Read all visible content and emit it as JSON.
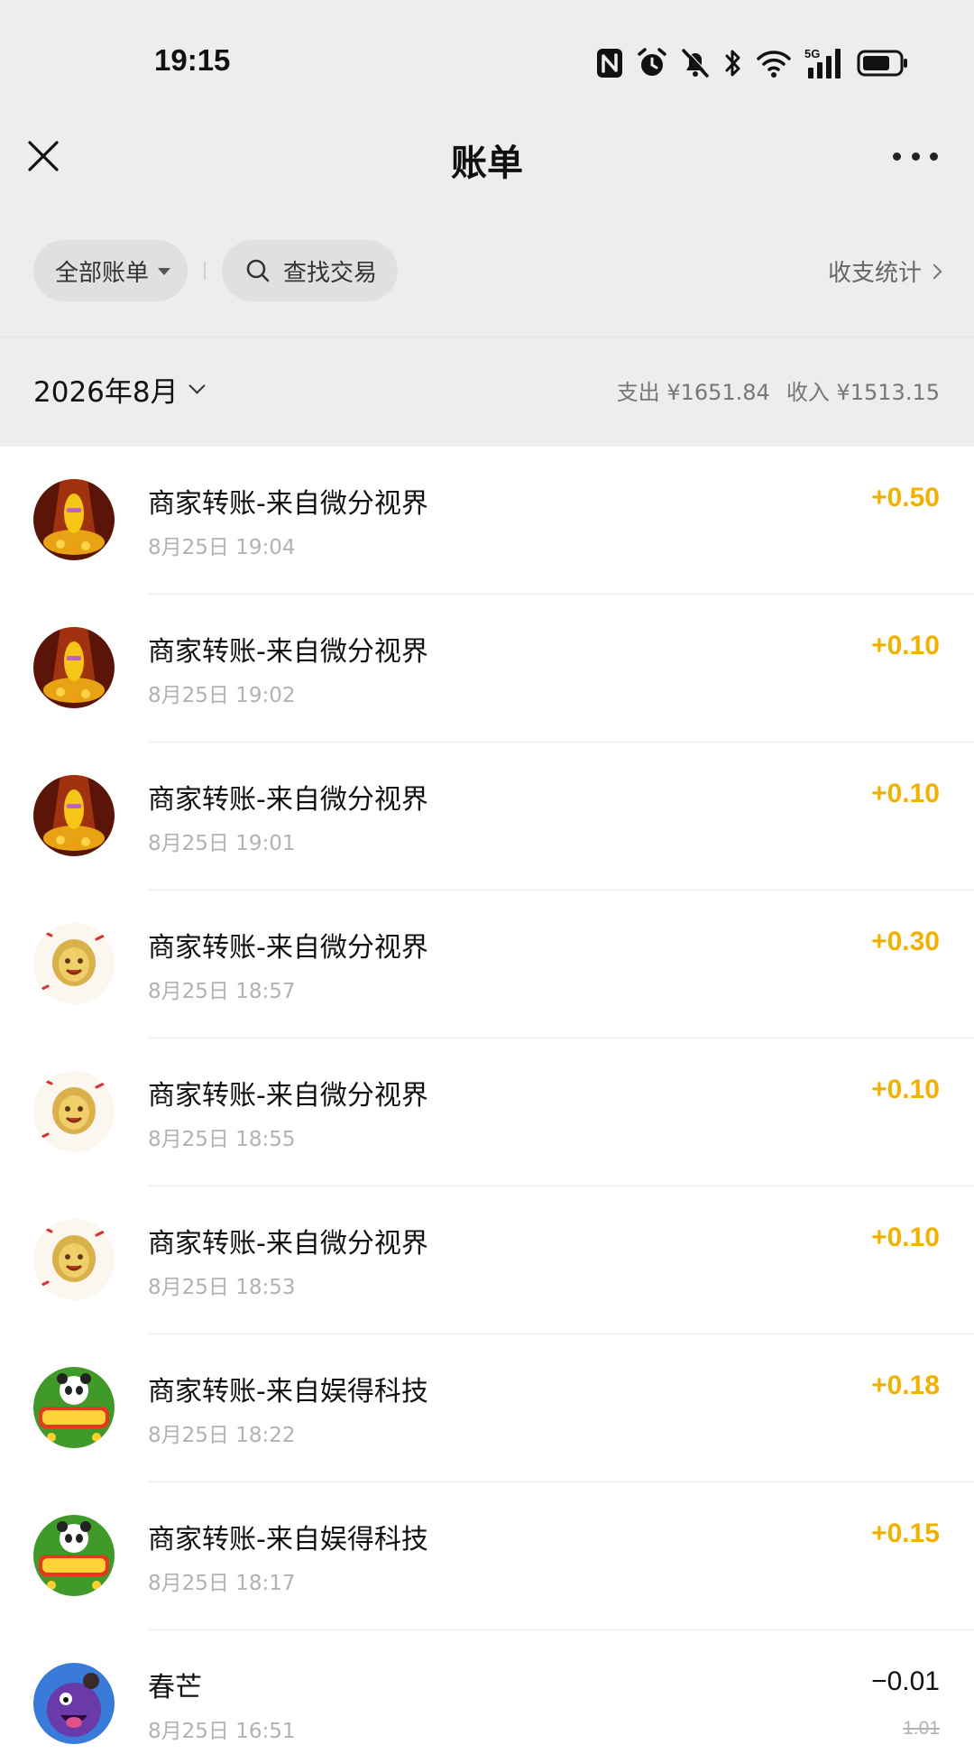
{
  "status_bar": {
    "time": "19:15",
    "icons": [
      "nfc-icon",
      "alarm-icon",
      "mute-icon",
      "bluetooth-icon",
      "wifi-icon",
      "signal-5g-icon",
      "battery-icon"
    ],
    "network_label": "5G"
  },
  "nav": {
    "title": "账单",
    "close_icon": "close-icon",
    "more_icon": "more-icon"
  },
  "filters": {
    "all_bills": "全部账单",
    "search": "查找交易",
    "stats": "收支统计"
  },
  "month_bar": {
    "month": "2026年8月",
    "expense": "支出 ¥1651.84",
    "income": "收入 ¥1513.15"
  },
  "colors": {
    "income_amount": "#f2b100",
    "expense_amount": "#111111",
    "header_bg": "#ededed"
  },
  "transactions": [
    {
      "title": "商家转账-来自微分视界",
      "time": "8月25日 19:04",
      "amount": "+0.50",
      "type": "income",
      "avatar": "banana-character-avatar"
    },
    {
      "title": "商家转账-来自微分视界",
      "time": "8月25日 19:02",
      "amount": "+0.10",
      "type": "income",
      "avatar": "banana-character-avatar"
    },
    {
      "title": "商家转账-来自微分视界",
      "time": "8月25日 19:01",
      "amount": "+0.10",
      "type": "income",
      "avatar": "banana-character-avatar"
    },
    {
      "title": "商家转账-来自微分视界",
      "time": "8月25日 18:57",
      "amount": "+0.30",
      "type": "income",
      "avatar": "durian-character-avatar"
    },
    {
      "title": "商家转账-来自微分视界",
      "time": "8月25日 18:55",
      "amount": "+0.10",
      "type": "income",
      "avatar": "durian-character-avatar"
    },
    {
      "title": "商家转账-来自微分视界",
      "time": "8月25日 18:53",
      "amount": "+0.10",
      "type": "income",
      "avatar": "durian-character-avatar"
    },
    {
      "title": "商家转账-来自娱得科技",
      "time": "8月25日 18:22",
      "amount": "+0.18",
      "type": "income",
      "avatar": "panda-game-avatar"
    },
    {
      "title": "商家转账-来自娱得科技",
      "time": "8月25日 18:17",
      "amount": "+0.15",
      "type": "income",
      "avatar": "panda-game-avatar"
    },
    {
      "title": "春芒",
      "time": "8月25日 16:51",
      "amount": "−0.01",
      "original_amount": "1.01",
      "type": "expense",
      "avatar": "purple-monster-avatar"
    }
  ]
}
